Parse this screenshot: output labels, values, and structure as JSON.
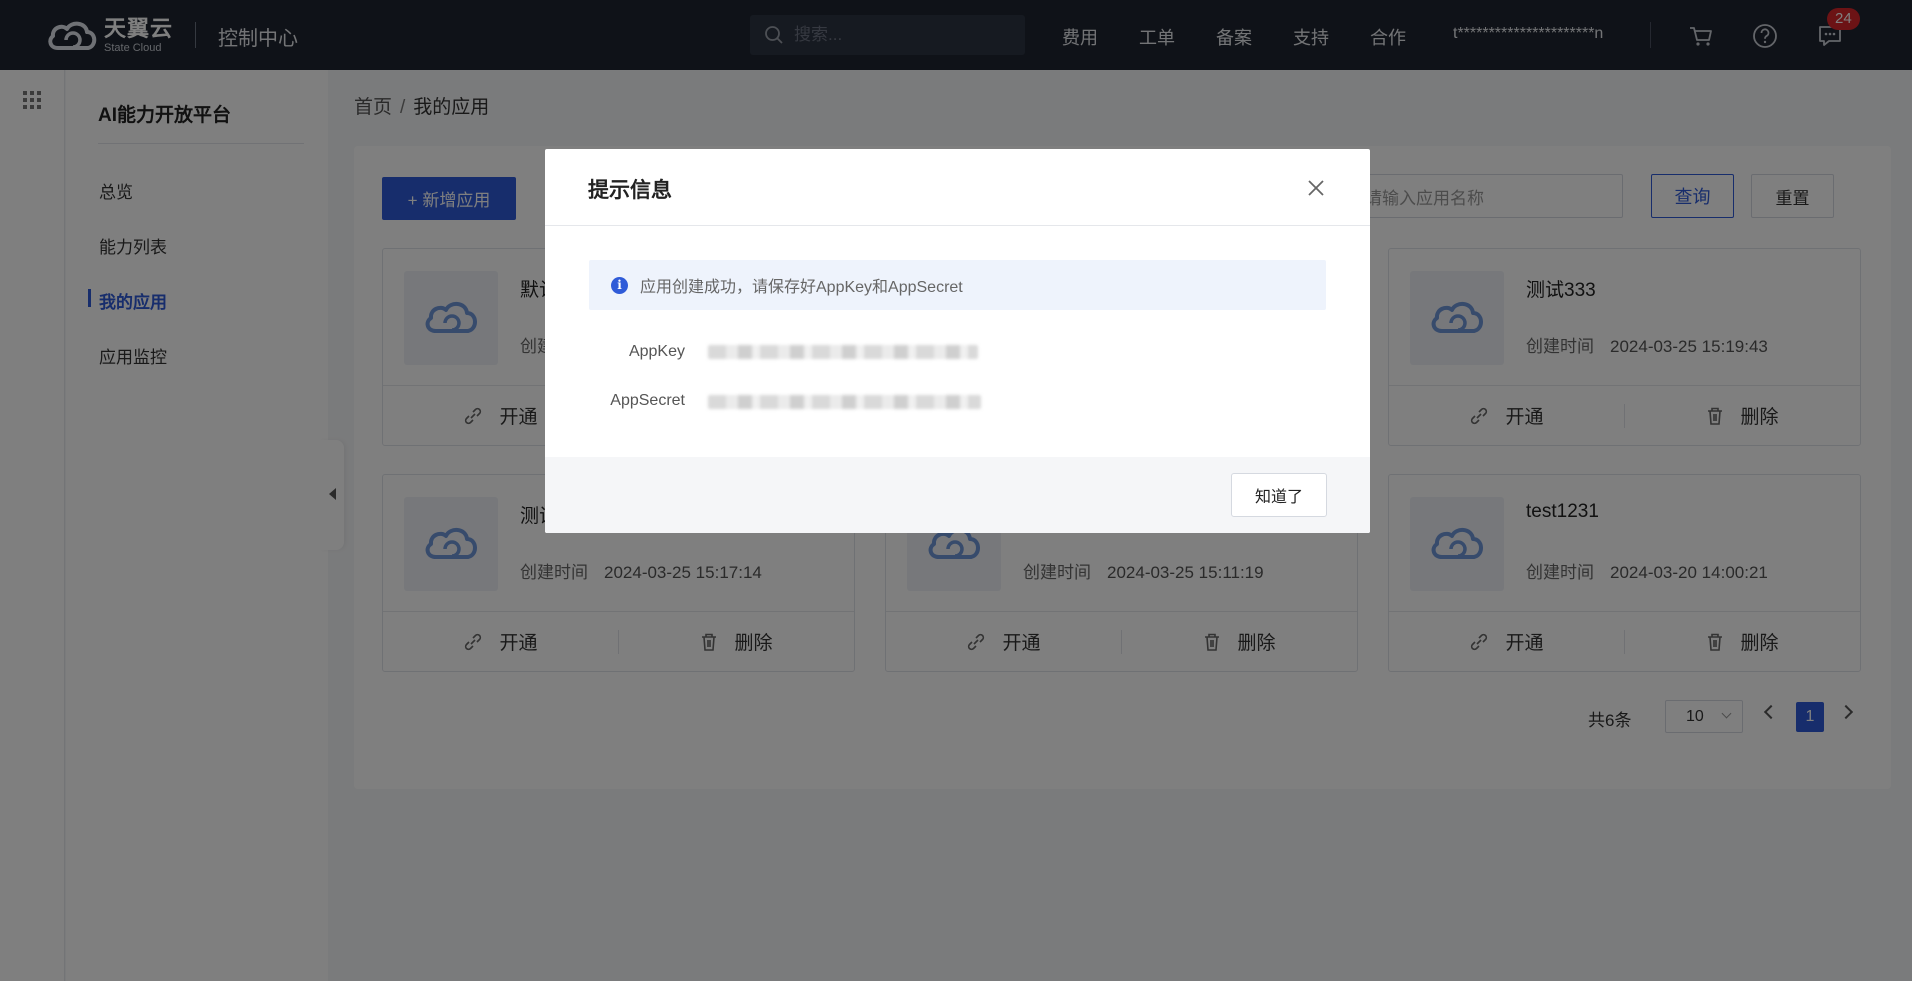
{
  "header": {
    "logo_cn": "天翼云",
    "logo_en": "State Cloud",
    "console_title": "控制中心",
    "search_placeholder": "搜索...",
    "nav": [
      "费用",
      "工单",
      "备案",
      "支持",
      "合作"
    ],
    "username": "t**********************n",
    "notification_count": "24",
    "icons": [
      "cart-icon",
      "help-icon",
      "message-icon"
    ]
  },
  "sidebar": {
    "title": "AI能力开放平台",
    "items": [
      {
        "label": "总览",
        "active": false
      },
      {
        "label": "能力列表",
        "active": false
      },
      {
        "label": "我的应用",
        "active": true
      },
      {
        "label": "应用监控",
        "active": false
      }
    ]
  },
  "breadcrumb": {
    "home": "首页",
    "separator": "/",
    "current": "我的应用"
  },
  "toolbar": {
    "add_label": "+ 新增应用",
    "search_placeholder": "请输入应用名称",
    "query_label": "查询",
    "reset_label": "重置"
  },
  "cards": [
    {
      "name": "默认",
      "created_label": "创建",
      "time": ""
    },
    {
      "name": "",
      "created_label": "",
      "time": ""
    },
    {
      "name": "测试333",
      "created_label": "创建时间",
      "time": "2024-03-25 15:19:43"
    },
    {
      "name": "测试",
      "created_label": "创建时间",
      "time": "2024-03-25 15:17:14"
    },
    {
      "name": "",
      "created_label": "创建时间",
      "time": "2024-03-25 15:11:19"
    },
    {
      "name": "test1231",
      "created_label": "创建时间",
      "time": "2024-03-20 14:00:21"
    }
  ],
  "card_actions": {
    "enable": "开通",
    "delete": "删除"
  },
  "pagination": {
    "total": "共6条",
    "page_size": "10",
    "current_page": "1"
  },
  "modal": {
    "title": "提示信息",
    "notice": "应用创建成功，请保存好AppKey和AppSecret",
    "appkey_label": "AppKey",
    "appsecret_label": "AppSecret",
    "ok_label": "知道了"
  },
  "colors": {
    "primary": "#2f5bd8",
    "topbar": "#1f2530",
    "badge": "#d8262b"
  }
}
